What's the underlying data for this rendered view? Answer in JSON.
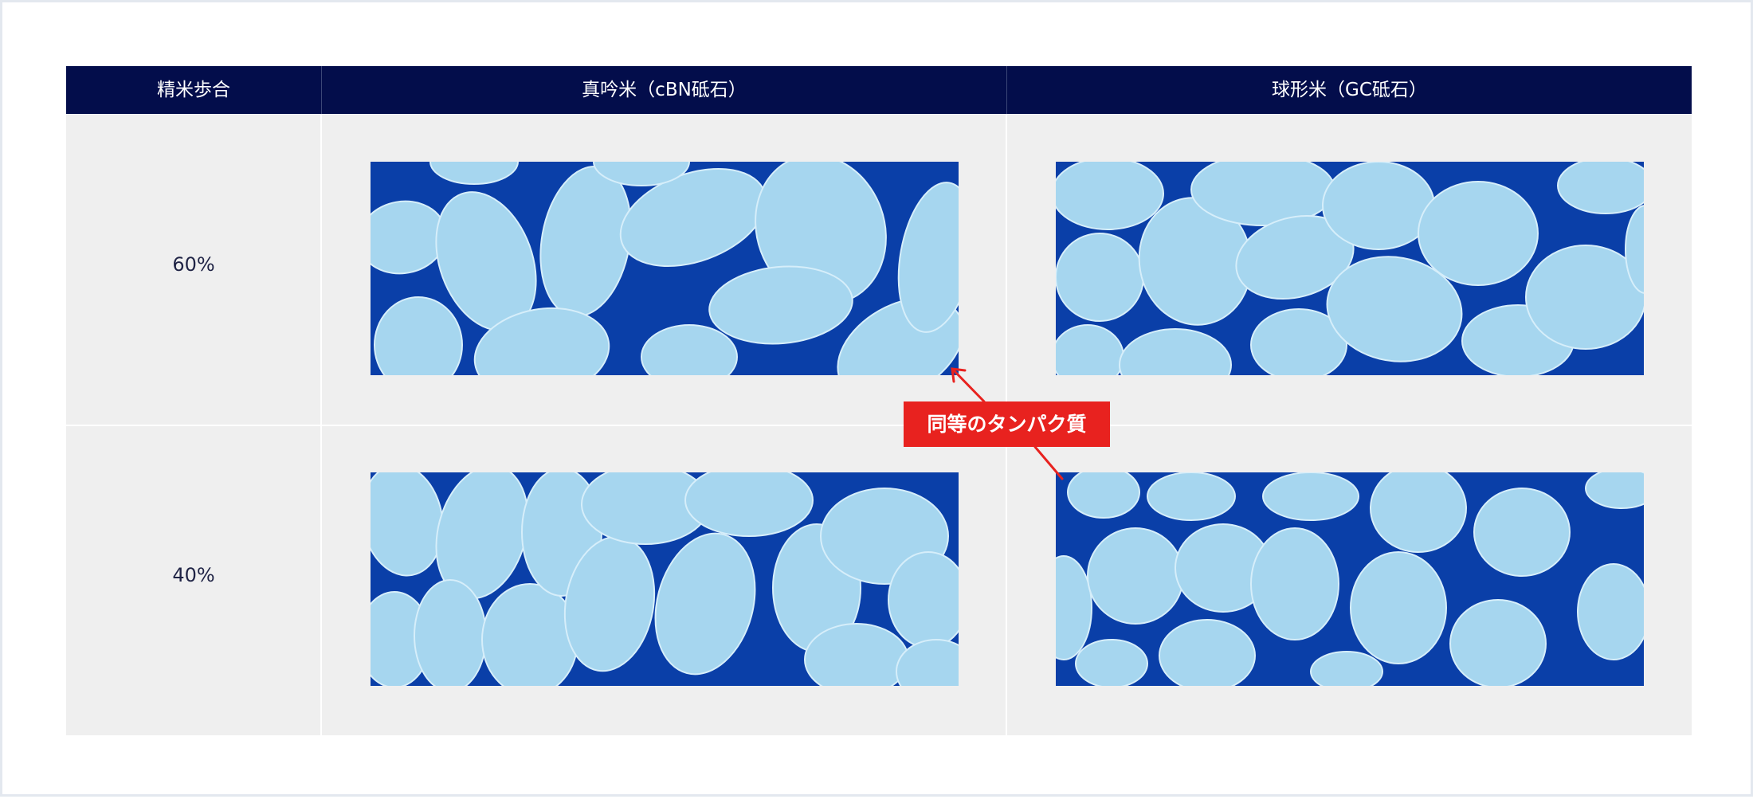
{
  "table": {
    "headers": [
      "精米歩合",
      "真吟米（cBN砥石）",
      "球形米（GC砥石）"
    ],
    "rows": [
      {
        "label": "60%",
        "images": [
          {
            "column": "真吟米（cBN砥石）",
            "grain_shape": "elongated"
          },
          {
            "column": "球形米（GC砥石）",
            "grain_shape": "rounded"
          }
        ]
      },
      {
        "label": "40%",
        "images": [
          {
            "column": "真吟米（cBN砥石）",
            "grain_shape": "elongated"
          },
          {
            "column": "球形米（GC砥石）",
            "grain_shape": "round"
          }
        ]
      }
    ]
  },
  "callout": {
    "text": "同等のタンパク質"
  },
  "colors": {
    "header_bg": "#030d4b",
    "cell_bg": "#efefef",
    "callout_bg": "#e8221f",
    "photo_bg": "#0a3fa8",
    "grain_fill": "#a6d6ef"
  }
}
